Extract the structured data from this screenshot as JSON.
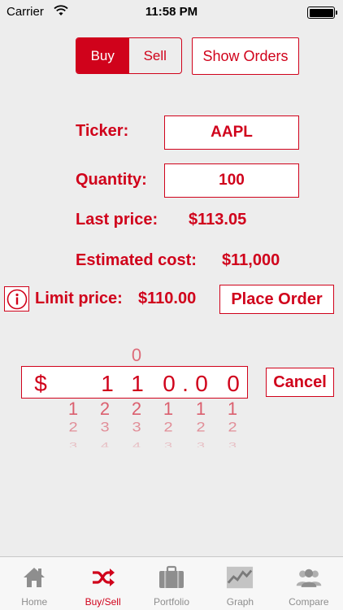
{
  "status_bar": {
    "carrier": "Carrier",
    "time": "11:58 PM"
  },
  "order_type": {
    "options": [
      "Buy",
      "Sell"
    ],
    "selected": "Buy"
  },
  "show_orders_label": "Show Orders",
  "form": {
    "ticker_label": "Ticker:",
    "ticker_value": "AAPL",
    "quantity_label": "Quantity:",
    "quantity_value": "100",
    "last_price_label": "Last price:",
    "last_price_value": "$113.05",
    "estimated_cost_label": "Estimated cost:",
    "estimated_cost_value": "$11,000",
    "limit_price_label": "Limit price:",
    "limit_price_value": "$110.00",
    "place_order_label": "Place Order"
  },
  "picker": {
    "currency": "$",
    "above": [
      "",
      "",
      "0",
      "",
      "",
      ""
    ],
    "selected": [
      "",
      "1",
      "1",
      "0",
      "0",
      "0"
    ],
    "decimal": ".",
    "below1": [
      "1",
      "2",
      "2",
      "1",
      "1",
      "1"
    ],
    "below2": [
      "2",
      "3",
      "3",
      "2",
      "2",
      "2"
    ],
    "below3": [
      "3",
      "4",
      "4",
      "3",
      "3",
      "3"
    ],
    "cancel_label": "Cancel"
  },
  "tabs": [
    {
      "label": "Home",
      "icon": "home-icon"
    },
    {
      "label": "Buy/Sell",
      "icon": "shuffle-icon",
      "active": true
    },
    {
      "label": "Portfolio",
      "icon": "briefcase-icon"
    },
    {
      "label": "Graph",
      "icon": "graph-icon"
    },
    {
      "label": "Compare",
      "icon": "people-icon"
    }
  ],
  "colors": {
    "accent": "#d0021b",
    "background": "#ededed",
    "tab_inactive": "#8e8e8e"
  }
}
